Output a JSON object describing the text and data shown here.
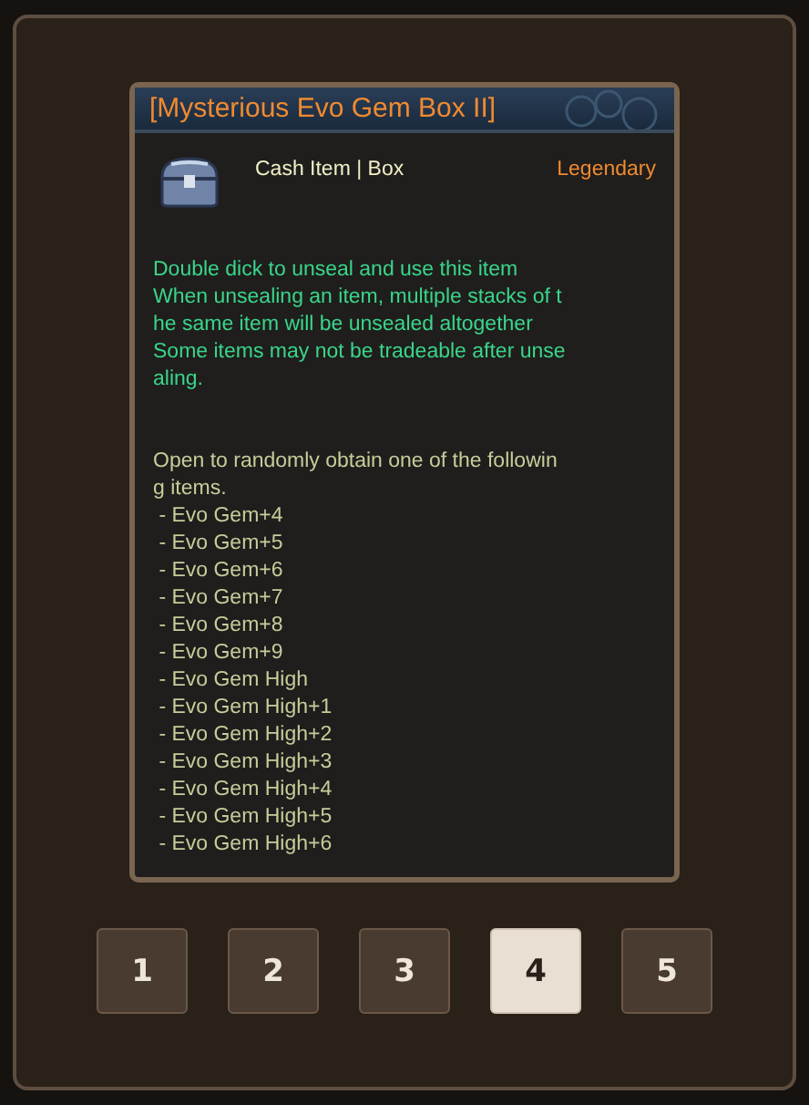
{
  "tooltip": {
    "title": "[Mysterious Evo Gem Box II]",
    "category": "Cash Item | Box",
    "rarity": "Legendary",
    "description_lines": [
      "Double dick to unseal and use this item",
      "When unsealing an item, multiple stacks of t",
      "he same item will be unsealed altogether",
      "Some items may not be tradeable after unse",
      "aling."
    ],
    "contents_lines": [
      "Open to randomly obtain one of the followin",
      "g items.",
      " - Evo Gem+4",
      " - Evo Gem+5",
      " - Evo Gem+6",
      " - Evo Gem+7",
      " - Evo Gem+8",
      " - Evo Gem+9",
      " - Evo Gem High",
      " - Evo Gem High+1",
      " - Evo Gem High+2",
      " - Evo Gem High+3",
      " - Evo Gem High+4",
      " - Evo Gem High+5",
      " - Evo Gem High+6"
    ]
  },
  "pages": [
    {
      "label": "1",
      "selected": false
    },
    {
      "label": "2",
      "selected": false
    },
    {
      "label": "3",
      "selected": false
    },
    {
      "label": "4",
      "selected": true
    },
    {
      "label": "5",
      "selected": false
    }
  ]
}
